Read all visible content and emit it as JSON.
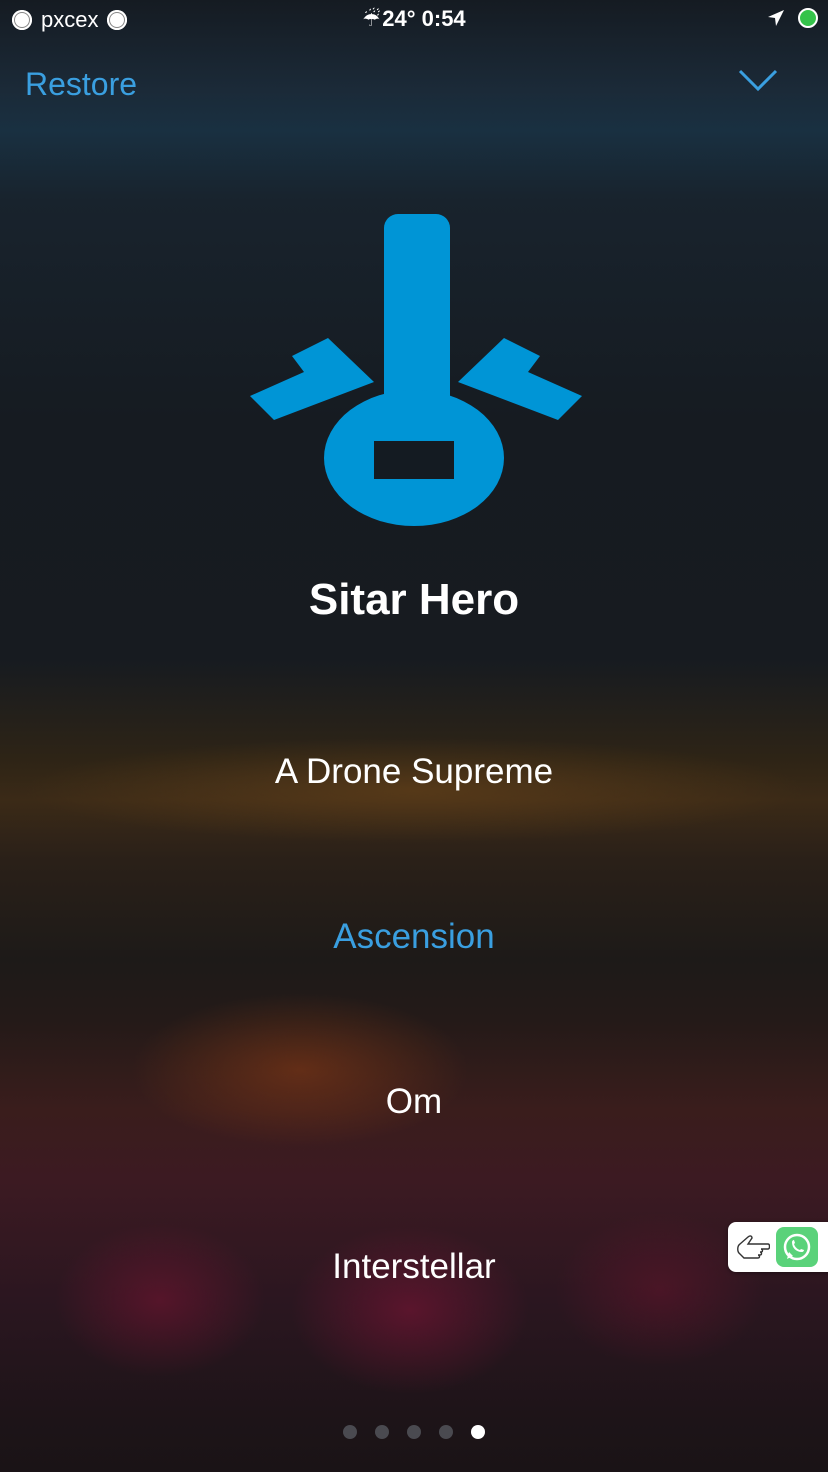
{
  "status_bar": {
    "carrier": "pxcex",
    "weather_icon": "rain-umbrella-icon",
    "time": "24° 0:54"
  },
  "header": {
    "restore_label": "Restore",
    "close_icon": "chevron-down-icon"
  },
  "app": {
    "title": "Sitar Hero",
    "logo_icon": "sitar-logo-icon",
    "accent_color": "#0095d6",
    "link_color": "#3a9fe0"
  },
  "tracks": [
    {
      "label": "A Drone Supreme",
      "selected": false
    },
    {
      "label": "Ascension",
      "selected": true
    },
    {
      "label": "Om",
      "selected": false
    },
    {
      "label": "Interstellar",
      "selected": false
    }
  ],
  "widget": {
    "hand_icon": "pointing-hand-icon",
    "app_icon": "whatsapp-icon"
  },
  "pager": {
    "total": 5,
    "current": 5
  }
}
